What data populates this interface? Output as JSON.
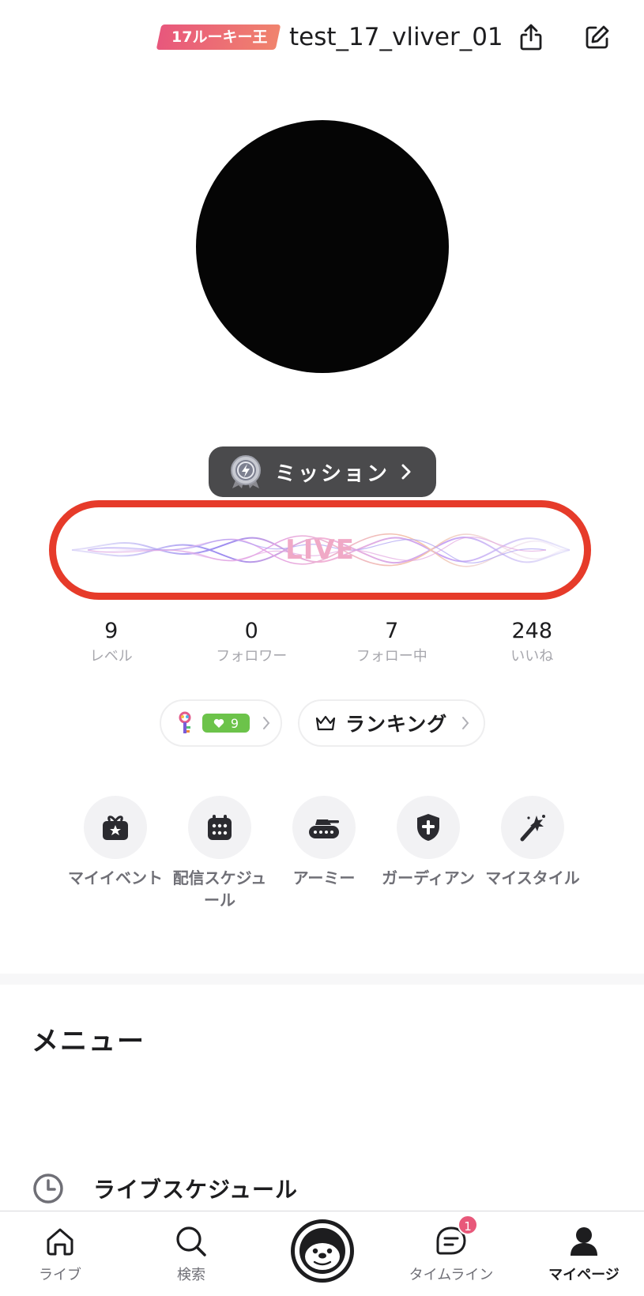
{
  "header": {
    "rank_badge": "17ルーキー王",
    "username": "test_17_vliver_01",
    "share_icon": "share-icon",
    "edit_icon": "edit-icon"
  },
  "mission": {
    "label": "ミッション"
  },
  "live": {
    "label": "LIVE"
  },
  "stats": [
    {
      "value": "9",
      "label": "レベル"
    },
    {
      "value": "0",
      "label": "フォロワー"
    },
    {
      "value": "7",
      "label": "フォロー中"
    },
    {
      "value": "248",
      "label": "いいね"
    }
  ],
  "chips": {
    "level_value": "9",
    "ranking_label": "ランキング"
  },
  "features": [
    {
      "label": "マイイベント",
      "icon": "gift-star-icon"
    },
    {
      "label": "配信スケジュール",
      "icon": "calendar-icon"
    },
    {
      "label": "アーミー",
      "icon": "tank-icon"
    },
    {
      "label": "ガーディアン",
      "icon": "shield-icon"
    },
    {
      "label": "マイスタイル",
      "icon": "magic-wand-icon"
    }
  ],
  "menu": {
    "title": "メニュー",
    "items": [
      {
        "label": "ライブスケジュール",
        "icon": "clock-icon"
      }
    ]
  },
  "nav": {
    "live": "ライブ",
    "search": "検索",
    "timeline": "タイムライン",
    "timeline_badge": "1",
    "mypage": "マイページ"
  },
  "colors": {
    "accent_red": "#e63b2a",
    "badge_pink": "#e8577c",
    "level_green": "#6cc34a",
    "mission_bg": "#4a4a4c"
  }
}
